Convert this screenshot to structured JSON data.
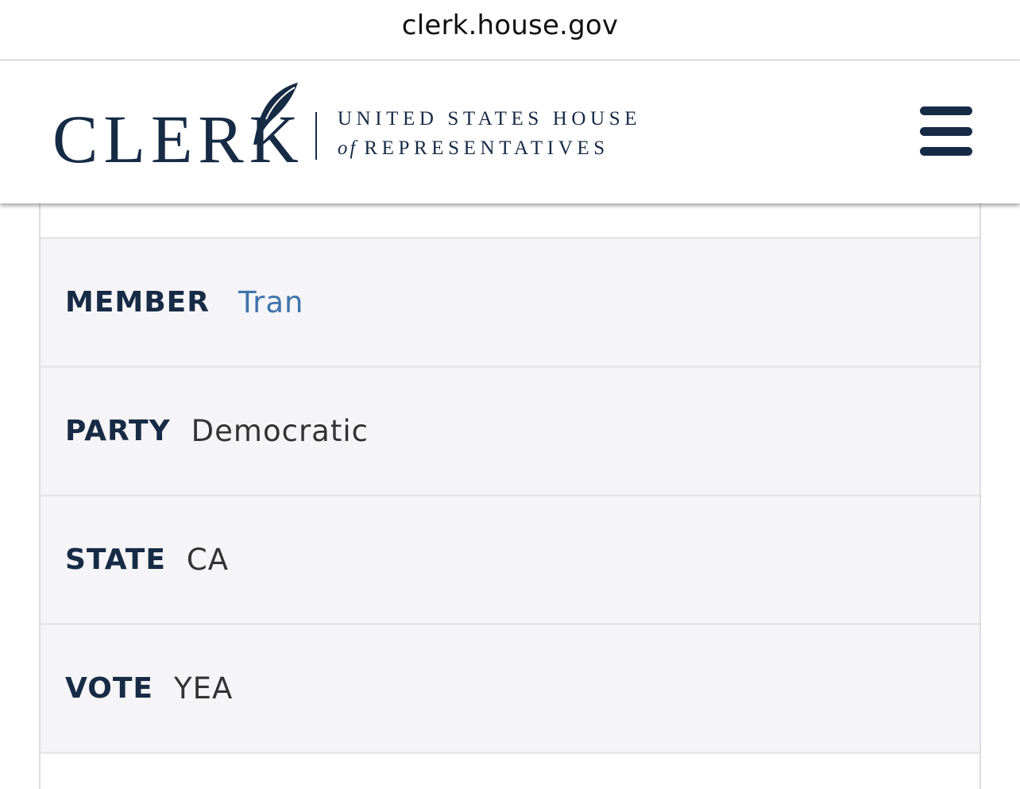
{
  "browser": {
    "url": "clerk.house.gov"
  },
  "header": {
    "logo_main": "CLERK",
    "logo_line1": "UNITED STATES HOUSE",
    "logo_of": "of",
    "logo_line2": "REPRESENTATIVES",
    "menu_icon": "hamburger-menu-icon"
  },
  "record": {
    "rows": [
      {
        "label": "MEMBER",
        "value": "Tran"
      },
      {
        "label": "PARTY",
        "value": "Democratic"
      },
      {
        "label": "STATE",
        "value": "CA"
      },
      {
        "label": "VOTE",
        "value": "YEA"
      }
    ]
  },
  "colors": {
    "brand_navy": "#172b45",
    "link_blue": "#3f73ac",
    "row_background": "#f5f5f7"
  }
}
